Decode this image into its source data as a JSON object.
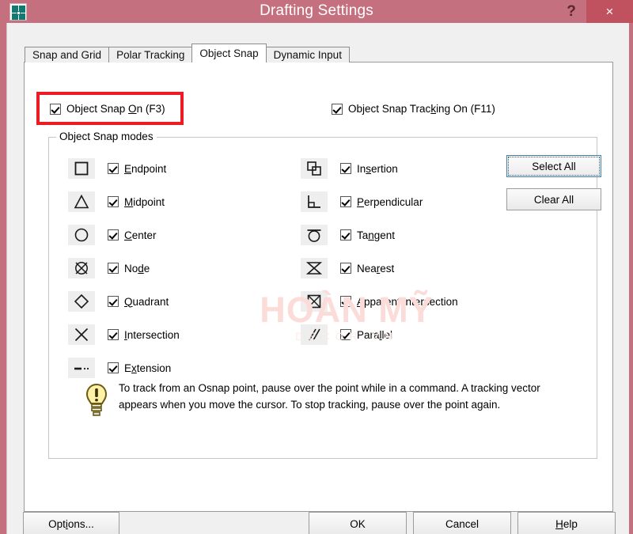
{
  "window": {
    "title": "Drafting Settings",
    "app_icon": "autocad-icon",
    "help_label": "?",
    "close_label": "×"
  },
  "watermark": {
    "main": "HOÀN MỸ",
    "sub": "DECOR.VN"
  },
  "tabs": [
    {
      "label": "Snap and Grid",
      "active": false
    },
    {
      "label": "Polar Tracking",
      "active": false
    },
    {
      "label": "Object Snap",
      "active": true
    },
    {
      "label": "Dynamic Input",
      "active": false
    }
  ],
  "top_checkboxes": {
    "object_snap_on": {
      "pre": "Object Snap ",
      "accel": "O",
      "post": "n (F3)",
      "checked": true,
      "highlighted": true
    },
    "object_snap_tracking_on": {
      "pre": "Object Snap Trac",
      "accel": "k",
      "post": "ing On (F11)",
      "checked": true,
      "highlighted": false
    }
  },
  "groupbox": {
    "title": "Object Snap modes",
    "left_modes": [
      {
        "glyph": "square-icon",
        "pre": "",
        "accel": "E",
        "post": "ndpoint",
        "checked": true
      },
      {
        "glyph": "triangle-icon",
        "pre": "",
        "accel": "M",
        "post": "idpoint",
        "checked": true
      },
      {
        "glyph": "circle-icon",
        "pre": "",
        "accel": "C",
        "post": "enter",
        "checked": true
      },
      {
        "glyph": "node-crossed-circle-icon",
        "pre": "No",
        "accel": "d",
        "post": "e",
        "checked": true
      },
      {
        "glyph": "diamond-icon",
        "pre": "",
        "accel": "Q",
        "post": "uadrant",
        "checked": true
      },
      {
        "glyph": "x-cross-icon",
        "pre": "",
        "accel": "I",
        "post": "ntersection",
        "checked": true
      },
      {
        "glyph": "extension-dash-icon",
        "pre": "E",
        "accel": "x",
        "post": "tension",
        "checked": true
      }
    ],
    "right_modes": [
      {
        "glyph": "insertion-icon",
        "pre": "In",
        "accel": "s",
        "post": "ertion",
        "checked": true
      },
      {
        "glyph": "perpendicular-icon",
        "pre": "",
        "accel": "P",
        "post": "erpendicular",
        "checked": true
      },
      {
        "glyph": "tangent-icon",
        "pre": "Ta",
        "accel": "n",
        "post": "gent",
        "checked": true
      },
      {
        "glyph": "nearest-bowtie-icon",
        "pre": "Nea",
        "accel": "r",
        "post": "est",
        "checked": true
      },
      {
        "glyph": "apparent-intersection-icon",
        "pre": "",
        "accel": "A",
        "post": "pparent intersection",
        "checked": true
      },
      {
        "glyph": "parallel-icon",
        "pre": "Para",
        "accel": "l",
        "post": "lel",
        "checked": true
      }
    ],
    "select_all_label": "Select All",
    "clear_all_label": "Clear All",
    "tip_icon": "lightbulb-icon",
    "tip_text": "To track from an Osnap point, pause over the point while in a command.  A tracking vector appears when you move the cursor.  To stop tracking, pause over the point again."
  },
  "bottom_buttons": {
    "options": {
      "pre": "Opt",
      "accel": "i",
      "post": "ons..."
    },
    "ok": {
      "pre": "OK",
      "accel": "",
      "post": ""
    },
    "cancel": {
      "pre": "Cancel",
      "accel": "",
      "post": ""
    },
    "help": {
      "pre": "",
      "accel": "H",
      "post": "elp"
    }
  },
  "colors": {
    "titlebar": "#c4707f",
    "close_button": "#c0525f",
    "highlight_red": "#ed1c24",
    "focus_blue": "#3c7fb1",
    "panel_bg": "#ffffff",
    "dialog_bg": "#f0f0f0"
  }
}
